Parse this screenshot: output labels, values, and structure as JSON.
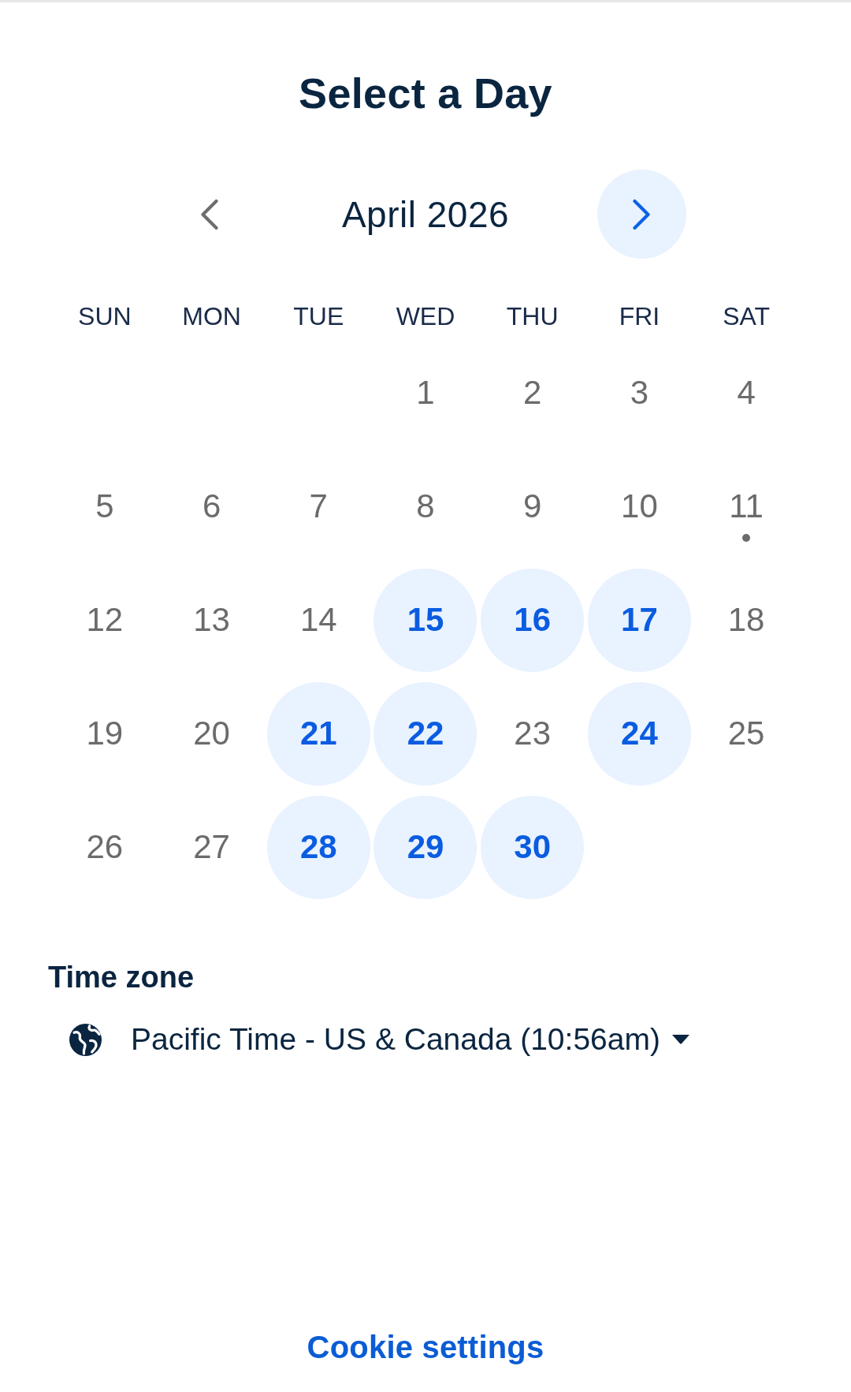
{
  "title": "Select a Day",
  "month_nav": {
    "previous": {
      "disabled": true
    },
    "label": "April 2026",
    "next": {
      "disabled": false
    }
  },
  "weekdays": [
    "SUN",
    "MON",
    "TUE",
    "WED",
    "THU",
    "FRI",
    "SAT"
  ],
  "days": [
    {
      "kind": "empty"
    },
    {
      "kind": "empty"
    },
    {
      "kind": "empty"
    },
    {
      "kind": "day",
      "label": "1",
      "available": false,
      "selected": false,
      "today": false
    },
    {
      "kind": "day",
      "label": "2",
      "available": false,
      "selected": false,
      "today": false
    },
    {
      "kind": "day",
      "label": "3",
      "available": false,
      "selected": false,
      "today": false
    },
    {
      "kind": "day",
      "label": "4",
      "available": false,
      "selected": false,
      "today": false
    },
    {
      "kind": "day",
      "label": "5",
      "available": false,
      "selected": false,
      "today": false
    },
    {
      "kind": "day",
      "label": "6",
      "available": false,
      "selected": false,
      "today": false
    },
    {
      "kind": "day",
      "label": "7",
      "available": false,
      "selected": false,
      "today": false
    },
    {
      "kind": "day",
      "label": "8",
      "available": false,
      "selected": false,
      "today": false
    },
    {
      "kind": "day",
      "label": "9",
      "available": false,
      "selected": false,
      "today": false
    },
    {
      "kind": "day",
      "label": "10",
      "available": false,
      "selected": false,
      "today": false
    },
    {
      "kind": "day",
      "label": "11",
      "available": false,
      "selected": false,
      "today": true
    },
    {
      "kind": "day",
      "label": "12",
      "available": false,
      "selected": false,
      "today": false
    },
    {
      "kind": "day",
      "label": "13",
      "available": false,
      "selected": false,
      "today": false
    },
    {
      "kind": "day",
      "label": "14",
      "available": false,
      "selected": false,
      "today": false
    },
    {
      "kind": "day",
      "label": "15",
      "available": true,
      "selected": false,
      "today": false
    },
    {
      "kind": "day",
      "label": "16",
      "available": true,
      "selected": false,
      "today": false
    },
    {
      "kind": "day",
      "label": "17",
      "available": true,
      "selected": false,
      "today": false
    },
    {
      "kind": "day",
      "label": "18",
      "available": false,
      "selected": false,
      "today": false
    },
    {
      "kind": "day",
      "label": "19",
      "available": false,
      "selected": false,
      "today": false
    },
    {
      "kind": "day",
      "label": "20",
      "available": false,
      "selected": false,
      "today": false
    },
    {
      "kind": "day",
      "label": "21",
      "available": true,
      "selected": false,
      "today": false
    },
    {
      "kind": "day",
      "label": "22",
      "available": true,
      "selected": false,
      "today": false
    },
    {
      "kind": "day",
      "label": "23",
      "available": false,
      "selected": false,
      "today": false
    },
    {
      "kind": "day",
      "label": "24",
      "available": true,
      "selected": false,
      "today": false
    },
    {
      "kind": "day",
      "label": "25",
      "available": false,
      "selected": false,
      "today": false
    },
    {
      "kind": "day",
      "label": "26",
      "available": false,
      "selected": false,
      "today": false
    },
    {
      "kind": "day",
      "label": "27",
      "available": false,
      "selected": false,
      "today": false
    },
    {
      "kind": "day",
      "label": "28",
      "available": true,
      "selected": false,
      "today": false
    },
    {
      "kind": "day",
      "label": "29",
      "available": true,
      "selected": false,
      "today": false
    },
    {
      "kind": "day",
      "label": "30",
      "available": true,
      "selected": false,
      "today": false
    }
  ],
  "time_zone": {
    "heading": "Time zone",
    "value": "Pacific Time - US & Canada (10:56am)"
  },
  "footer": {
    "link": "Cookie settings"
  }
}
